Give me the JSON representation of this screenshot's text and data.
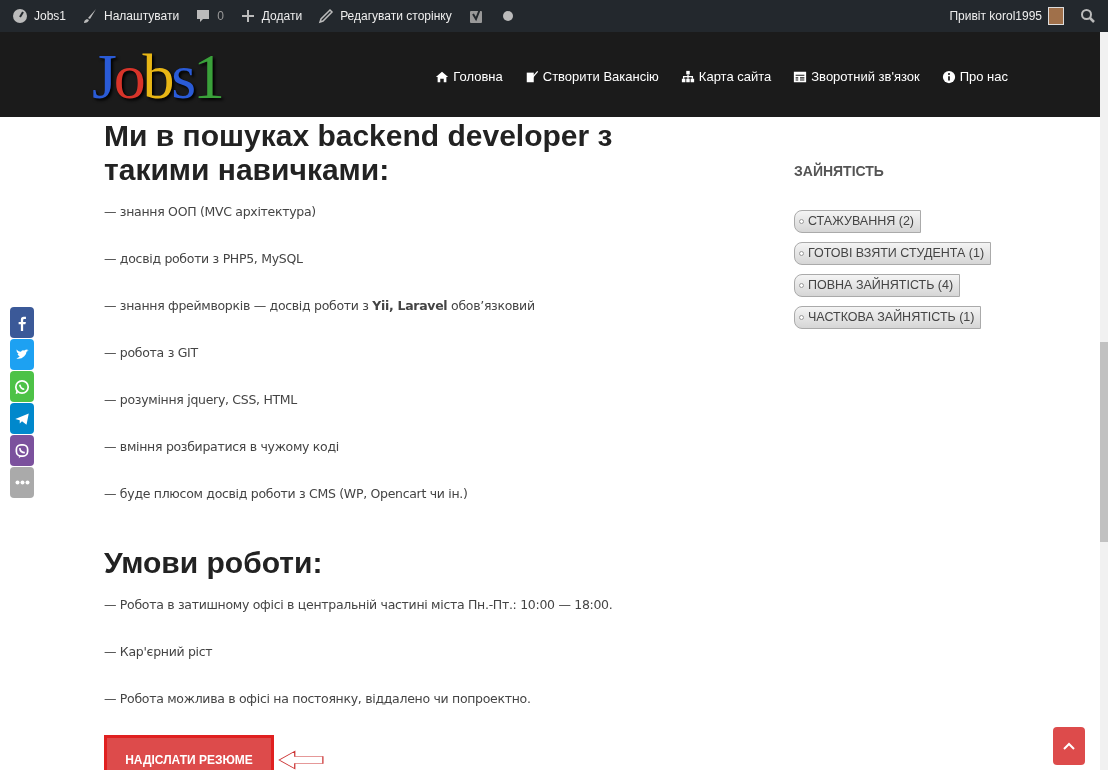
{
  "admin_bar": {
    "site": "Jobs1",
    "items": [
      {
        "kind": "brush",
        "label": "Налаштувати"
      },
      {
        "kind": "comment",
        "label": "0"
      },
      {
        "kind": "plus",
        "label": "Додати"
      },
      {
        "kind": "pencil",
        "label": "Редагувати сторінку"
      },
      {
        "kind": "yoast"
      },
      {
        "kind": "dot"
      }
    ],
    "greeting": "Привіт korol1995"
  },
  "header": {
    "logo": "Jobs1",
    "nav": [
      {
        "kind": "home",
        "label": "Головна"
      },
      {
        "kind": "edit",
        "label": "Створити Вакансію"
      },
      {
        "kind": "sitemap",
        "label": "Карта сайта"
      },
      {
        "kind": "form",
        "label": "Зворотний зв'язок"
      },
      {
        "kind": "info",
        "label": "Про нас"
      }
    ]
  },
  "sections": [
    {
      "heading": "Ми в пошуках backend developer з такими навичками:",
      "items": [
        "— знання ООП (MVC архітектура)",
        "— досвід роботи з PHP5, MySQL",
        "— знання фреймворків — досвід роботи з **Yii, Laravel** обов’язковий",
        "— робота з GIT",
        "— розуміння jquery, CSS, HTML",
        "— вміння розбиратися в чужому коді",
        "— буде плюсом досвід роботи з CMS (WP, Opencart чи ін.)"
      ]
    },
    {
      "heading": "Умови роботи:",
      "items": [
        "— Робота в затишному офісі в центральній частині міста Пн.-Пт.: 10:00 — 18:00.",
        "— Кар'єрний ріст",
        "— Робота можлива в офісі на постоянку, віддалено чи попроектно."
      ]
    }
  ],
  "apply_button": "НАДІСЛАТИ РЕЗЮМЕ",
  "sidebar": {
    "title": "ЗАЙНЯТІСТЬ",
    "tags": [
      "СТАЖУВАННЯ (2)",
      "ГОТОВІ ВЗЯТИ СТУДЕНТА (1)",
      "ПОВНА ЗАЙНЯТІСТЬ (4)",
      "ЧАСТКОВА ЗАЙНЯТІСТЬ (1)"
    ]
  },
  "share": [
    {
      "kind": "facebook"
    },
    {
      "kind": "twitter"
    },
    {
      "kind": "whatsapp"
    },
    {
      "kind": "telegram"
    },
    {
      "kind": "viber"
    },
    {
      "kind": "more"
    }
  ]
}
